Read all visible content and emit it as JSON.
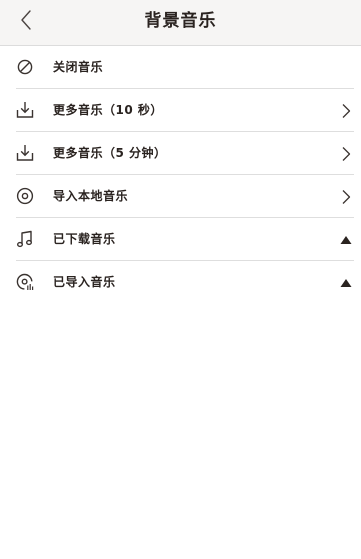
{
  "header": {
    "title": "背景音乐",
    "back_icon": "chevron-left-icon"
  },
  "menu": {
    "items": [
      {
        "label": "关闭音乐",
        "icon": "disabled-icon",
        "trail": "none"
      },
      {
        "label": "更多音乐（10 秒）",
        "icon": "download-icon",
        "trail": "chevron-right-icon"
      },
      {
        "label": "更多音乐（5 分钟）",
        "icon": "download-icon",
        "trail": "chevron-right-icon"
      },
      {
        "label": "导入本地音乐",
        "icon": "disc-icon",
        "trail": "chevron-right-icon"
      },
      {
        "label": "已下载音乐",
        "icon": "music-note-icon",
        "trail": "triangle-up-icon"
      },
      {
        "label": "已导入音乐",
        "icon": "imported-music-icon",
        "trail": "triangle-up-icon"
      }
    ]
  },
  "colors": {
    "header_bg": "#f6f5f4",
    "text": "#2a2320",
    "divider": "#dedede",
    "icon": "#3a3330"
  }
}
